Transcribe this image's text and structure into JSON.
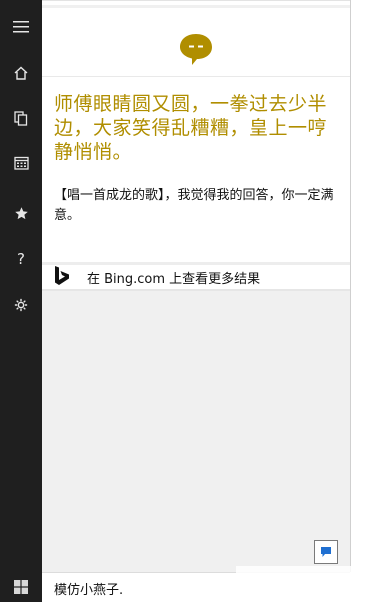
{
  "sidebar": {
    "icons": [
      "menu-icon",
      "home-icon",
      "notebook-icon",
      "calendar-icon",
      "star-icon",
      "help-icon",
      "settings-icon"
    ],
    "help_glyph": "?"
  },
  "card": {
    "badge_icon": "speech-bubble-icon",
    "badge_color": "#b08e00",
    "answer": "师傅眼睛圆又圆，一拳过去少半边，大家笑得乱糟糟，皇上一哼静悄悄。",
    "reply": "【唱一首成龙的歌】，我觉得我的回答，你一定满意。"
  },
  "bing": {
    "label": "在 Bing.com 上查看更多结果",
    "icon": "bing-logo-icon"
  },
  "input": {
    "query": "模仿小燕子."
  },
  "colors": {
    "rail_bg": "#1f1f1f",
    "accent_gold": "#b08e00",
    "panel_bg": "#f0f0f0"
  }
}
